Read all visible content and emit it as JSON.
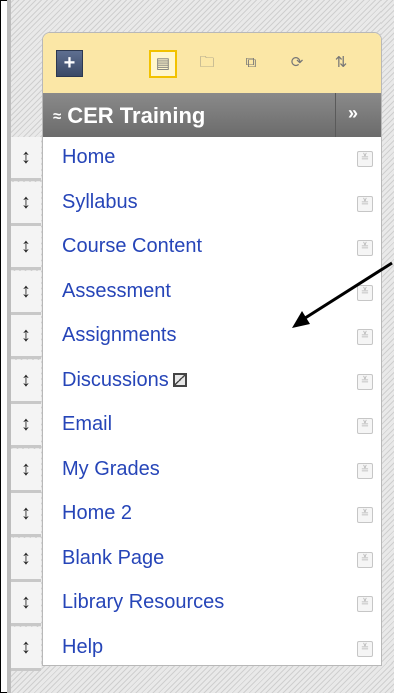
{
  "toolbar": {
    "add_icon": "plus-icon",
    "tools": [
      {
        "icon": "list-view-icon",
        "glyph": "▤",
        "active": true
      },
      {
        "icon": "folder-icon",
        "glyph": "🗀",
        "active": false
      },
      {
        "icon": "window-icon",
        "glyph": "⧉",
        "active": false
      },
      {
        "icon": "refresh-icon",
        "glyph": "⟳",
        "active": false
      },
      {
        "icon": "sort-icon",
        "glyph": "⇅",
        "active": false
      }
    ],
    "accent_color": "#fbe7a6"
  },
  "header": {
    "title": "CER Training",
    "collapse_glyph": "≈",
    "expand_glyph": "»"
  },
  "menu": {
    "items": [
      {
        "label": "Home"
      },
      {
        "label": "Syllabus"
      },
      {
        "label": "Course Content"
      },
      {
        "label": "Assessment"
      },
      {
        "label": "Assignments"
      },
      {
        "label": "Discussions",
        "has_edit_icon": true
      },
      {
        "label": "Email"
      },
      {
        "label": "My Grades"
      },
      {
        "label": "Home 2"
      },
      {
        "label": "Blank Page"
      },
      {
        "label": "Library Resources"
      },
      {
        "label": "Help"
      }
    ],
    "link_color": "#2645b8"
  }
}
